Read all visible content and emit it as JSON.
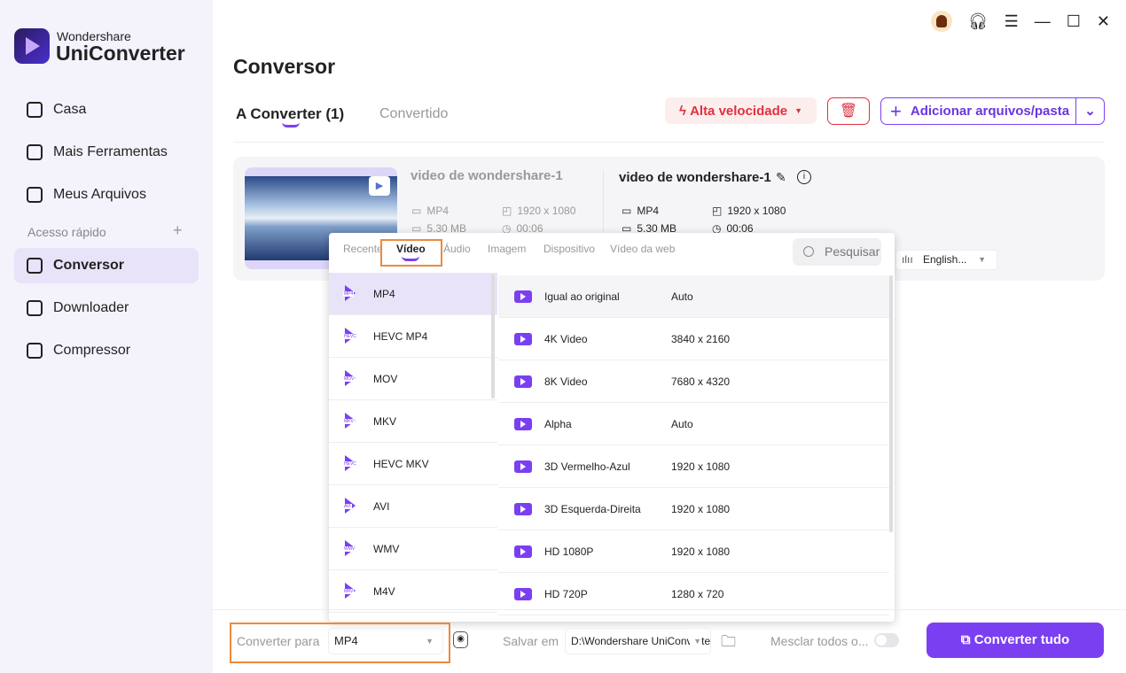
{
  "brand": {
    "line1": "Wondershare",
    "line2": "UniConverter"
  },
  "sidebar": {
    "items": [
      {
        "label": "Casa"
      },
      {
        "label": "Mais Ferramentas"
      },
      {
        "label": "Meus Arquivos"
      }
    ],
    "quick_access": "Acesso rápido",
    "quick_items": [
      {
        "label": "Conversor",
        "active": true
      },
      {
        "label": "Downloader"
      },
      {
        "label": "Compressor"
      }
    ]
  },
  "header": {
    "title": "Conversor",
    "tabs": [
      {
        "label": "A Converter (1)",
        "active": true
      },
      {
        "label": "Convertido"
      }
    ],
    "speed_label": "Alta velocidade",
    "add_label": "Adicionar arquivos/pasta"
  },
  "file": {
    "source": {
      "name": "video de wondershare-1",
      "format": "MP4",
      "resolution": "1920 x 1080",
      "size": "5.30 MB",
      "duration": "00:06"
    },
    "target": {
      "name": "video de wondershare-1",
      "format": "MP4",
      "resolution": "1920 x 1080",
      "size": "5.30 MB",
      "duration": "00:06"
    },
    "audio_track": "English..."
  },
  "popup": {
    "tabs": [
      "Recente",
      "Vídeo",
      "Áudio",
      "Imagem",
      "Dispositivo",
      "Vídeo da web"
    ],
    "active_tab": "Vídeo",
    "search_placeholder": "Pesquisar",
    "formats": [
      {
        "label": "MP4",
        "badge": "MP4",
        "selected": true
      },
      {
        "label": "HEVC MP4",
        "badge": "HEVC"
      },
      {
        "label": "MOV",
        "badge": "MOV"
      },
      {
        "label": "MKV",
        "badge": "MKV"
      },
      {
        "label": "HEVC MKV",
        "badge": "HEVC"
      },
      {
        "label": "AVI",
        "badge": "AVI"
      },
      {
        "label": "WMV",
        "badge": "WMV"
      },
      {
        "label": "M4V",
        "badge": "M4V"
      }
    ],
    "presets": [
      {
        "name": "Igual ao original",
        "resolution": "Auto",
        "selected": true
      },
      {
        "name": "4K Video",
        "resolution": "3840 x 2160"
      },
      {
        "name": "8K Video",
        "resolution": "7680 x 4320"
      },
      {
        "name": "Alpha",
        "resolution": "Auto"
      },
      {
        "name": "3D Vermelho-Azul",
        "resolution": "1920 x 1080"
      },
      {
        "name": "3D Esquerda-Direita",
        "resolution": "1920 x 1080"
      },
      {
        "name": "HD 1080P",
        "resolution": "1920 x 1080"
      },
      {
        "name": "HD 720P",
        "resolution": "1280 x 720"
      }
    ]
  },
  "bottom": {
    "convert_to_label": "Converter para",
    "convert_to_value": "MP4",
    "save_label": "Salvar em",
    "save_path": "D:\\Wondershare UniConverter",
    "merge_label": "Mesclar todos o...",
    "merge_on": false,
    "convert_all": "Converter tudo"
  },
  "colors": {
    "accent": "#7b3ff2",
    "danger": "#e0313d",
    "highlight": "#ec8a3c"
  }
}
